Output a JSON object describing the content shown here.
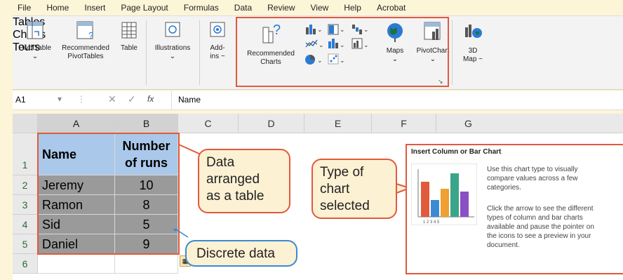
{
  "tabs": [
    "File",
    "Home",
    "Insert",
    "Page Layout",
    "Formulas",
    "Data",
    "Review",
    "View",
    "Help",
    "Acrobat"
  ],
  "ribbon": {
    "pivot_table": "PivotTable",
    "rec_pivot": [
      "Recommended",
      "PivotTables"
    ],
    "table": "Table",
    "illustrations": "Illustrations",
    "addins": [
      "Add-",
      "ins ~"
    ],
    "rec_charts": [
      "Recommended",
      "Charts"
    ],
    "maps": "Maps",
    "pivot_chart": "PivotChart",
    "map3d": [
      "3D",
      "Map ~"
    ],
    "groups": {
      "tables": "Tables",
      "charts": "Charts",
      "tours": "Tours"
    }
  },
  "formula_bar": {
    "name_box": "A1",
    "fx": "fx",
    "value": "Name"
  },
  "columns": [
    "A",
    "B",
    "C",
    "D",
    "E",
    "F",
    "G"
  ],
  "rows": [
    "1",
    "2",
    "3",
    "4",
    "5",
    "6"
  ],
  "table": {
    "headers": [
      "Name",
      "Number of runs"
    ],
    "rows": [
      [
        "Jeremy",
        "10"
      ],
      [
        "Ramon",
        "8"
      ],
      [
        "Sid",
        "5"
      ],
      [
        "Daniel",
        "9"
      ]
    ]
  },
  "callouts": {
    "data_table": [
      "Data",
      "arranged",
      "as a table"
    ],
    "chart_type": [
      "Type of",
      "chart",
      "selected"
    ],
    "discrete": "Discrete data"
  },
  "tooltip": {
    "title": "Insert Column or Bar Chart",
    "p1": [
      "Use this chart type to visually",
      "compare values across a few",
      "categories."
    ],
    "p2": [
      "Click the arrow to see the different",
      "types of column and bar charts",
      "available and pause the pointer on",
      "the icons to see a preview in your",
      "document."
    ]
  },
  "colors": {
    "accent_green": "#1e7145",
    "callout_red": "#e05a3c",
    "callout_blue": "#3a8bd1",
    "header_blue": "#aac8ea",
    "data_grey": "#9a9a9a"
  }
}
